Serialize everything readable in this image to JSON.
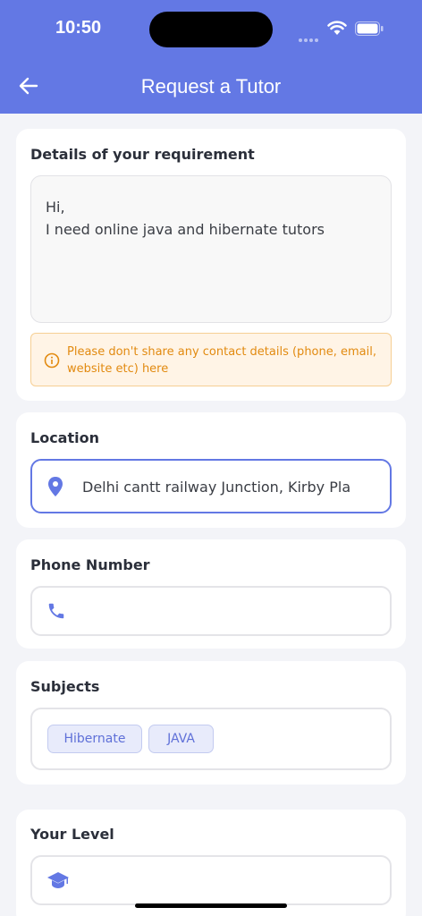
{
  "status_bar": {
    "time": "10:50"
  },
  "header": {
    "title": "Request a Tutor",
    "back_icon": "arrow-left-icon"
  },
  "requirement": {
    "title": "Details of your requirement",
    "line1": "Hi,",
    "line2": "I need online java and hibernate tutors",
    "warning": "Please don't share any contact details (phone, email, website etc) here"
  },
  "location": {
    "title": "Location",
    "value": "Delhi cantt railway Junction, Kirby Pla"
  },
  "phone": {
    "title": "Phone Number",
    "value": ""
  },
  "subjects": {
    "title": "Subjects",
    "tags": [
      "Hibernate",
      "JAVA"
    ]
  },
  "level": {
    "title": "Your Level",
    "value": ""
  },
  "colors": {
    "primary": "#6378e4",
    "warning_text": "#e28a10",
    "warning_bg": "#fff4e6"
  }
}
